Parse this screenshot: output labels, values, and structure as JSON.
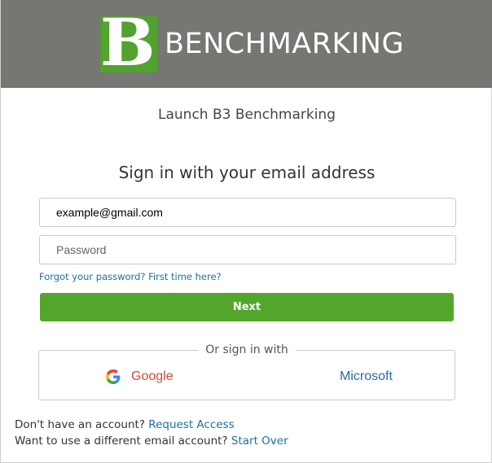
{
  "header": {
    "logo_mark": "B3",
    "logo_word": "BENCHMARKING"
  },
  "launch_title": "Launch B3 Benchmarking",
  "signin_heading": "Sign in with your email address",
  "form": {
    "email_value": "example@gmail.com",
    "password_placeholder": "Password",
    "forgot_link": "Forgot your password? First time here?",
    "next_label": "Next"
  },
  "social": {
    "divider_label": "Or sign in with",
    "google_label": "Google",
    "microsoft_label": "Microsoft",
    "google_icon": "google-icon",
    "microsoft_icon": "microsoft-icon"
  },
  "footer": {
    "no_account_text": "Don't have an account?",
    "request_access_link": "Request Access",
    "different_account_text": "Want to use a different email account?",
    "start_over_link": "Start Over"
  },
  "colors": {
    "header_bg": "#767673",
    "brand_green": "#52a62c",
    "link_blue": "#1d6fa5",
    "google_red": "#d14836",
    "microsoft_blue": "#2a6ca3"
  }
}
